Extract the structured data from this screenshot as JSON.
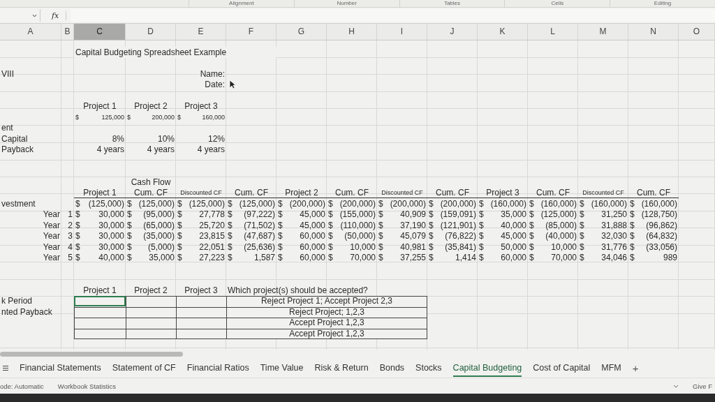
{
  "ribbon_groups": [
    "Alignment",
    "Number",
    "Tables",
    "Cells",
    "Editing"
  ],
  "formula_bar": {
    "fx": "fx"
  },
  "columns": [
    {
      "label": "A",
      "selected": false
    },
    {
      "label": "B",
      "selected": false
    },
    {
      "label": "C",
      "selected": true
    },
    {
      "label": "D",
      "selected": false
    },
    {
      "label": "E",
      "selected": false
    },
    {
      "label": "F",
      "selected": false
    },
    {
      "label": "G",
      "selected": false
    },
    {
      "label": "H",
      "selected": false
    },
    {
      "label": "I",
      "selected": false
    },
    {
      "label": "J",
      "selected": false
    },
    {
      "label": "K",
      "selected": false
    },
    {
      "label": "L",
      "selected": false
    },
    {
      "label": "M",
      "selected": false
    },
    {
      "label": "N",
      "selected": false
    },
    {
      "label": "O",
      "selected": false
    }
  ],
  "title": "Capital Budgeting Spreadsheet Example",
  "info": {
    "section_label": "VIII",
    "fields": [
      "Name:",
      "Date:"
    ]
  },
  "projects": {
    "headers": [
      "Project 1",
      "Project 2",
      "Project 3"
    ],
    "costs": [
      {
        "symbol": "$",
        "amount": "125,000"
      },
      {
        "symbol": "$",
        "amount": "200,000"
      },
      {
        "symbol": "$",
        "amount": "160,000"
      }
    ],
    "rows": [
      {
        "label": "ent"
      },
      {
        "label": "Capital",
        "values": [
          "8%",
          "10%",
          "12%"
        ]
      },
      {
        "label": "Payback",
        "values": [
          "4 years",
          "4 years",
          "4 years"
        ]
      }
    ]
  },
  "cash_flow": {
    "title": "Cash Flow",
    "columns": [
      {
        "label": "Project 1",
        "small": false
      },
      {
        "label": "Cum. CF",
        "small": false
      },
      {
        "label": "Discounted CF",
        "small": true
      },
      {
        "label": "Cum. CF",
        "small": false
      },
      {
        "label": "Project 2",
        "small": false
      },
      {
        "label": "Cum. CF",
        "small": false
      },
      {
        "label": "Discounted CF",
        "small": true
      },
      {
        "label": "Cum. CF",
        "small": false
      },
      {
        "label": "Project 3",
        "small": false
      },
      {
        "label": "Cum. CF",
        "small": false
      },
      {
        "label": "Discounted CF",
        "small": true
      },
      {
        "label": "Cum. CF",
        "small": false
      }
    ],
    "rows": [
      {
        "label": "vestment",
        "symbol": "$",
        "values": [
          "(125,000)",
          "(125,000)",
          "(125,000)",
          "(125,000)",
          "(200,000)",
          "(200,000)",
          "(200,000)",
          "(200,000)",
          "(160,000)",
          "(160,000)",
          "(160,000)",
          "(160,000)"
        ]
      },
      {
        "label": "Year",
        "year": "1",
        "symbol": "$",
        "values": [
          "30,000",
          "(95,000)",
          "27,778",
          "(97,222)",
          "45,000",
          "(155,000)",
          "40,909",
          "(159,091)",
          "35,000",
          "(125,000)",
          "31,250",
          "(128,750)"
        ]
      },
      {
        "label": "Year",
        "year": "2",
        "symbol": "$",
        "values": [
          "30,000",
          "(65,000)",
          "25,720",
          "(71,502)",
          "45,000",
          "(110,000)",
          "37,190",
          "(121,901)",
          "40,000",
          "(85,000)",
          "31,888",
          "(96,862)"
        ]
      },
      {
        "label": "Year",
        "year": "3",
        "symbol": "$",
        "values": [
          "30,000",
          "(35,000)",
          "23,815",
          "(47,687)",
          "60,000",
          "(50,000)",
          "45,079",
          "(76,822)",
          "45,000",
          "(40,000)",
          "32,030",
          "(64,832)"
        ]
      },
      {
        "label": "Year",
        "year": "4",
        "symbol": "$",
        "values": [
          "30,000",
          "(5,000)",
          "22,051",
          "(25,636)",
          "60,000",
          "10,000",
          "40,981",
          "(35,841)",
          "50,000",
          "10,000",
          "31,776",
          "(33,056)"
        ]
      },
      {
        "label": "Year",
        "year": "5",
        "symbol": "$",
        "values": [
          "40,000",
          "35,000",
          "27,223",
          "1,587",
          "60,000",
          "70,000",
          "37,255",
          "1,414",
          "60,000",
          "70,000",
          "34,046",
          "989"
        ]
      }
    ]
  },
  "decision": {
    "headers": [
      "Project 1",
      "Project 2",
      "Project 3"
    ],
    "question": "Which project(s) should be accepted?",
    "rows": [
      {
        "label": "k Period",
        "answer": "Reject Project 1; Accept Project 2,3",
        "selected": true
      },
      {
        "label": "nted Payback",
        "answer": "Reject Project; 1,2,3",
        "selected": false
      },
      {
        "answer": "Accept Project 1,2,3",
        "selected": false
      },
      {
        "answer": "Accept Project 1,2,3",
        "selected": false
      }
    ]
  },
  "sheet_tabs": [
    {
      "label": "Financial Statements",
      "selected": false
    },
    {
      "label": "Statement of CF",
      "selected": false
    },
    {
      "label": "Financial Ratios",
      "selected": false
    },
    {
      "label": "Time Value",
      "selected": false
    },
    {
      "label": "Risk & Return",
      "selected": false
    },
    {
      "label": "Bonds",
      "selected": false
    },
    {
      "label": "Stocks",
      "selected": false
    },
    {
      "label": "Capital Budgeting",
      "selected": true
    },
    {
      "label": "Cost of Capital",
      "selected": false
    },
    {
      "label": "MFM",
      "selected": false
    }
  ],
  "add_sheet": "+",
  "status_bar": {
    "items": [
      "ode: Automatic",
      "Workbook Statistics"
    ],
    "right": "Give F"
  }
}
